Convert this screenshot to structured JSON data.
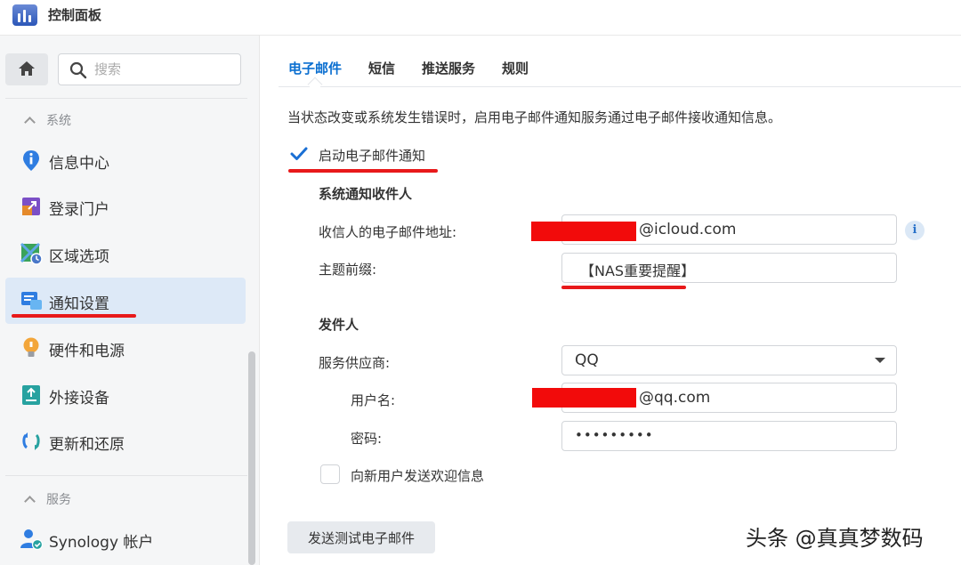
{
  "window": {
    "title": "控制面板"
  },
  "sidebar": {
    "search_placeholder": "搜索",
    "sections": [
      {
        "label": "系统"
      },
      {
        "label": "服务"
      }
    ],
    "items": [
      {
        "label": "信息中心",
        "icon": "info-pin-icon"
      },
      {
        "label": "登录门户",
        "icon": "login-portal-icon"
      },
      {
        "label": "区域选项",
        "icon": "regional-options-icon"
      },
      {
        "label": "通知设置",
        "icon": "notification-icon",
        "active": true
      },
      {
        "label": "硬件和电源",
        "icon": "bulb-icon"
      },
      {
        "label": "外接设备",
        "icon": "external-device-icon"
      },
      {
        "label": "更新和还原",
        "icon": "update-restore-icon"
      },
      {
        "label": "Synology 帐户",
        "icon": "synology-account-icon"
      }
    ]
  },
  "tabs": [
    {
      "label": "电子邮件",
      "active": true
    },
    {
      "label": "短信"
    },
    {
      "label": "推送服务"
    },
    {
      "label": "规则"
    }
  ],
  "email": {
    "description": "当状态改变或系统发生错误时，启用电子邮件通知服务通过电子邮件接收通知信息。",
    "enable_label": "启动电子邮件通知",
    "enable_checked": true,
    "recipient_section": "系统通知收件人",
    "recipient_label": "收信人的电子邮件地址:",
    "recipient_value": "@icloud.com",
    "subject_label": "主题前缀:",
    "subject_value": "【NAS重要提醒】",
    "sender_section": "发件人",
    "provider_label": "服务供应商:",
    "provider_value": "QQ",
    "username_label": "用户名:",
    "username_value": "@qq.com",
    "password_label": "密码:",
    "password_value": "•••••••••",
    "welcome_label": "向新用户发送欢迎信息",
    "welcome_checked": false,
    "test_button": "发送测试电子邮件"
  },
  "watermark": {
    "text": "头条 @真真梦数码"
  },
  "colors": {
    "accent": "#0b6fd0",
    "annotation_red": "#e8191a",
    "active_bg": "#dde9f7"
  }
}
